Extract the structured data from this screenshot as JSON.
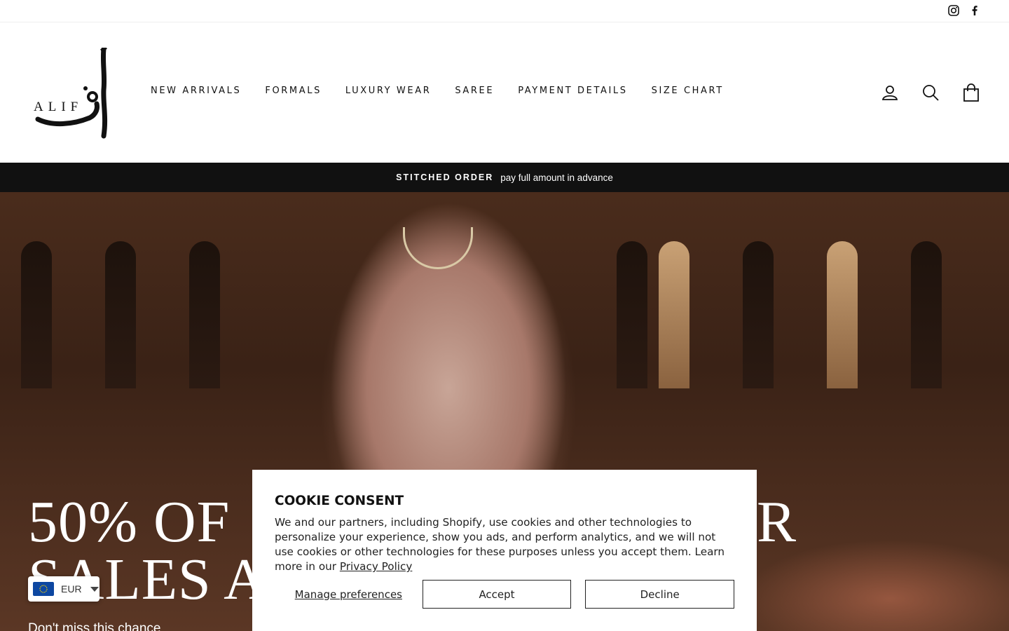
{
  "utility": {
    "social_icons": [
      "instagram-icon",
      "facebook-icon"
    ]
  },
  "header": {
    "logo_text": "ALIF",
    "nav": [
      "NEW ARRIVALS",
      "FORMALS",
      "LUXURY WEAR",
      "SAREE",
      "PAYMENT DETAILS",
      "SIZE CHART"
    ],
    "icons": [
      "user-icon",
      "search-icon",
      "cart-icon"
    ]
  },
  "announcement": {
    "strong": "STITCHED ORDER",
    "text": "pay full amount in advance"
  },
  "hero": {
    "title_line1": "50% OF",
    "title_line1_end": "R",
    "title_line2": "SALES A",
    "subtitle": "Don't miss this chance"
  },
  "currency": {
    "code": "EUR",
    "flag": "eu-flag-icon"
  },
  "cookie": {
    "title": "COOKIE CONSENT",
    "body": "We and our partners, including Shopify, use cookies and other technologies to personalize your experience, show you ads, and perform analytics, and we will not use cookies or other technologies for these purposes unless you accept them. Learn more in our ",
    "privacy_link": "Privacy Policy",
    "manage": "Manage preferences",
    "accept": "Accept",
    "decline": "Decline"
  },
  "colors": {
    "announcement_bg": "#111111",
    "hero_bg": "#4a2c1c"
  }
}
